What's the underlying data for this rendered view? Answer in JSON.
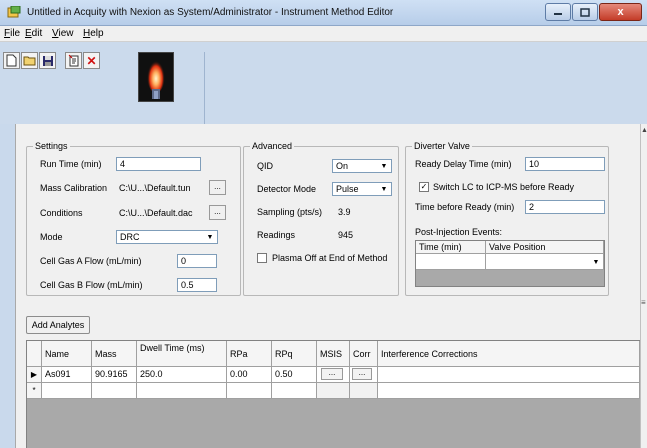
{
  "window": {
    "title": "Untitled in Acquity with Nexion as System/Administrator - Instrument Method Editor",
    "close_glyph": "x"
  },
  "menu": [
    {
      "label": "File",
      "mnemonic": "F",
      "rest": "ile"
    },
    {
      "label": "Edit",
      "mnemonic": "E",
      "rest": "dit"
    },
    {
      "label": "View",
      "mnemonic": "V",
      "rest": "iew"
    },
    {
      "label": "Help",
      "mnemonic": "H",
      "rest": "elp"
    }
  ],
  "toolbar": {
    "icons": [
      "new-file-icon",
      "open-folder-icon",
      "save-icon",
      "properties-icon",
      "delete-icon"
    ],
    "delete_glyph": "✕"
  },
  "settings": {
    "legend": "Settings",
    "run_time_label": "Run Time (min)",
    "run_time_value": "4",
    "mass_calibration_label": "Mass Calibration",
    "mass_calibration_value": "C:\\U...\\Default.tun",
    "conditions_label": "Conditions",
    "conditions_value": "C:\\U...\\Default.dac",
    "mode_label": "Mode",
    "mode_value": "DRC",
    "gas_a_label": "Cell Gas A Flow (mL/min)",
    "gas_a_value": "0",
    "gas_b_label": "Cell Gas B Flow (mL/min)",
    "gas_b_value": "0.5",
    "browse_label": "..."
  },
  "advanced": {
    "legend": "Advanced",
    "qid_label": "QID",
    "qid_value": "On",
    "detector_mode_label": "Detector Mode",
    "detector_mode_value": "Pulse",
    "sampling_label": "Sampling (pts/s)",
    "sampling_value": "3.9",
    "readings_label": "Readings",
    "readings_value": "945",
    "plasma_off_label": "Plasma Off at End of Method",
    "plasma_off_checked": false
  },
  "diverter": {
    "legend": "Diverter Valve",
    "ready_delay_label": "Ready Delay Time (min)",
    "ready_delay_value": "10",
    "switch_lc_label": "Switch LC to ICP-MS before Ready",
    "switch_lc_checked": true,
    "time_before_ready_label": "Time before Ready (min)",
    "time_before_ready_value": "2",
    "post_injection_label": "Post-Injection Events:",
    "col_time": "Time (min)",
    "col_valve": "Valve Position"
  },
  "analytes": {
    "add_button": "Add Analytes",
    "columns": [
      "Name",
      "Mass",
      "Dwell Time (ms)",
      "RPa",
      "RPq",
      "MSIS",
      "Corr",
      "Interference Corrections"
    ],
    "rows": [
      {
        "marker": "▶",
        "name": "As091",
        "mass": "90.9165",
        "dwell": "250.0",
        "rpa": "0.00",
        "rpq": "0.50",
        "msis": "...",
        "corr": "...",
        "interf": ""
      }
    ],
    "new_row_marker": "*"
  },
  "colors": {
    "title_bar": "#b7cde9",
    "toolbar_bg": "#cbdaec",
    "panel_bg": "#f0f0f0",
    "close_button": "#c43c28"
  }
}
